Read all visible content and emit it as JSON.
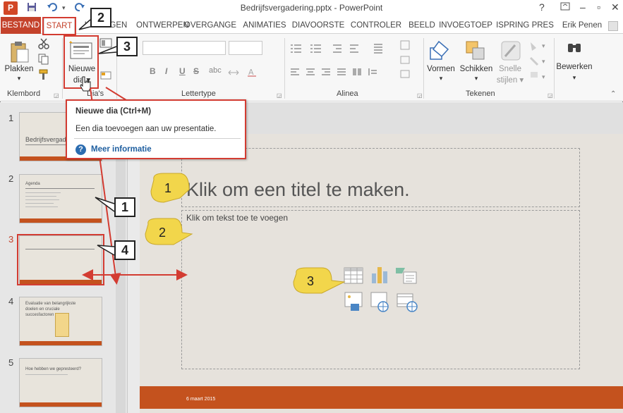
{
  "window": {
    "title": "Bedrijfsvergadering.pptx - PowerPoint",
    "help_glyph": "?",
    "minimize_glyph": "–",
    "restore_glyph": "▫",
    "close_glyph": "✕"
  },
  "tabs": [
    {
      "label": "BESTAND"
    },
    {
      "label": "START"
    },
    {
      "label": "INVOEGEN"
    },
    {
      "label": "ONTWERPEN"
    },
    {
      "label": "OVERGANGE"
    },
    {
      "label": "ANIMATIES"
    },
    {
      "label": "DIAVOORSTE"
    },
    {
      "label": "CONTROLER"
    },
    {
      "label": "BEELD"
    },
    {
      "label": "INVOEGTOEP"
    },
    {
      "label": "ISPRING PRES"
    }
  ],
  "user": {
    "name": "Erik Penen"
  },
  "ribbon": {
    "clipboard_group": "Klembord",
    "paste_label": "Plakken",
    "new_slide_line1": "Nieuwe",
    "new_slide_line2": "dia",
    "slides_group": "Dia's",
    "font_group": "Lettertype",
    "paragraph_group": "Alinea",
    "drawing_group": "Tekenen",
    "shapes_label": "Vormen",
    "arrange_label": "Schikken",
    "quickstyles_line1": "Snelle",
    "quickstyles_line2": "stijlen",
    "editing_label": "Bewerken",
    "bold": "B",
    "italic": "I",
    "underline": "U",
    "strike": "S",
    "abc": "abc"
  },
  "tooltip": {
    "title": "Nieuwe dia (Ctrl+M)",
    "description": "Een dia toevoegen aan uw presentatie.",
    "help_glyph": "?",
    "link": "Meer informatie"
  },
  "thumbnails": [
    {
      "number": "1",
      "title": "Bedrijfsvergad"
    },
    {
      "number": "2",
      "title": "Agenda"
    },
    {
      "number": "3",
      "title": ""
    },
    {
      "number": "4",
      "title": "Evaluatie van belangrijkste doelen en cruciale succesfactoren"
    },
    {
      "number": "5",
      "title": "Hoe hebben we gepresteerd?"
    }
  ],
  "slide": {
    "title_placeholder": "Klik om een titel te maken.",
    "body_placeholder": "Klik om tekst toe te voegen",
    "footer_date": "6 maart 2015"
  },
  "callouts": {
    "box1": "1",
    "box2": "2",
    "box3": "3",
    "box4": "4",
    "yellow1": "1",
    "yellow2": "2",
    "yellow3": "3"
  },
  "colors": {
    "accent_red": "#c4422b",
    "highlight_red": "#d33c32",
    "slide_orange": "#c4521e",
    "callout_yellow": "#f2d64b"
  }
}
